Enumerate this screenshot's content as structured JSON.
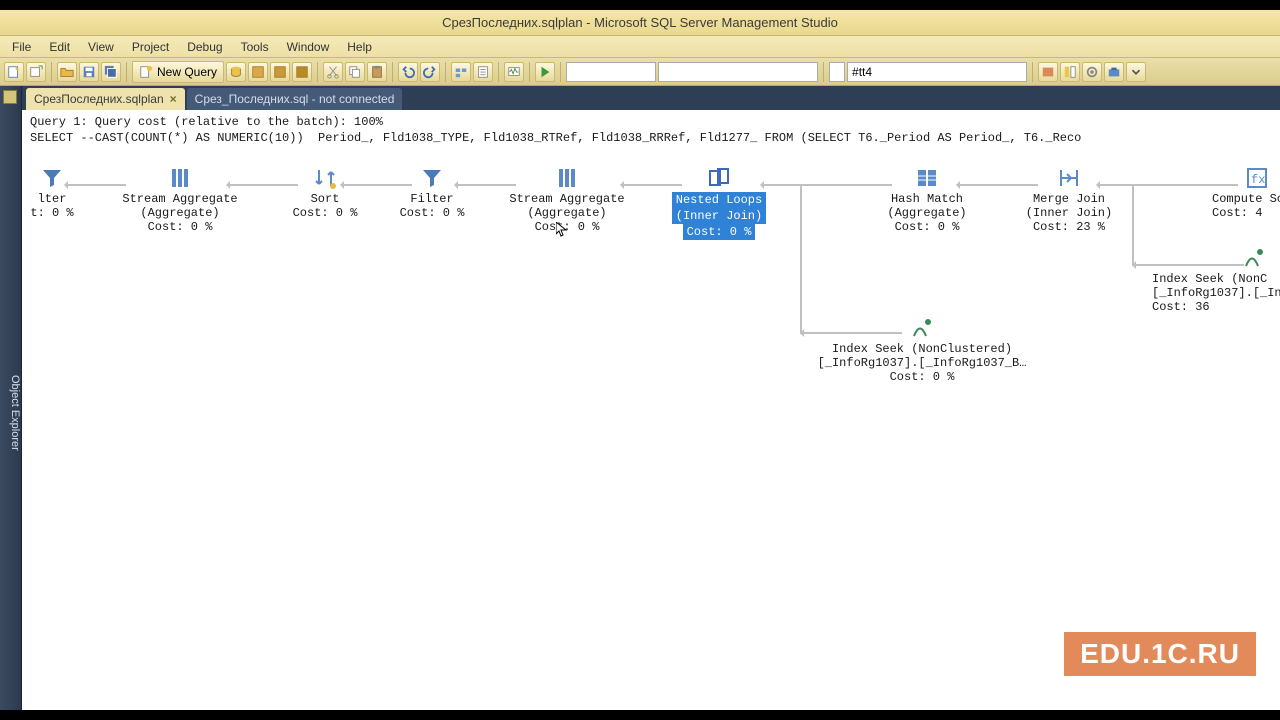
{
  "title": "СрезПоследних.sqlplan - Microsoft SQL Server Management Studio",
  "menu": [
    "File",
    "Edit",
    "View",
    "Project",
    "Debug",
    "Tools",
    "Window",
    "Help"
  ],
  "toolbar": {
    "new_query": "New Query",
    "combo_value": "#tt4"
  },
  "explorer_label": "Object Explorer",
  "tabs": [
    {
      "label": "СрезПоследних.sqlplan",
      "active": true,
      "closable": true
    },
    {
      "label": "Срез_Последних.sql - not connected",
      "active": false,
      "closable": false
    }
  ],
  "plan_header": {
    "line1": "Query 1: Query cost (relative to the batch): 100%",
    "line2": "SELECT --CAST(COUNT(*) AS NUMERIC(10))  Period_, Fld1038_TYPE, Fld1038_RTRef, Fld1038_RRRef, Fld1277_ FROM (SELECT T6._Period AS Period_, T6._Reco"
  },
  "nodes": {
    "filter_left": {
      "l1": "lter",
      "l2": "t: 0 %"
    },
    "stream_agg1": {
      "l1": "Stream Aggregate",
      "l2": "(Aggregate)",
      "l3": "Cost: 0 %"
    },
    "sort": {
      "l1": "Sort",
      "l2": "Cost: 0 %"
    },
    "filter": {
      "l1": "Filter",
      "l2": "Cost: 0 %"
    },
    "stream_agg2": {
      "l1": "Stream Aggregate",
      "l2": "(Aggregate)",
      "l3": "Cost: 0 %"
    },
    "nested": {
      "l1": "Nested Loops",
      "l2": "(Inner Join)",
      "l3": "Cost: 0 %"
    },
    "hash": {
      "l1": "Hash Match",
      "l2": "(Aggregate)",
      "l3": "Cost: 0 %"
    },
    "merge": {
      "l1": "Merge Join",
      "l2": "(Inner Join)",
      "l3": "Cost: 23 %"
    },
    "compute": {
      "l1": "Compute Sc",
      "l2": "Cost: 4"
    },
    "seek_top": {
      "l1": "Index Seek (NonC",
      "l2": "[_InfoRg1037].[_In",
      "l3": "Cost: 36"
    },
    "seek_bot": {
      "l1": "Index Seek (NonClustered)",
      "l2": "[_InfoRg1037].[_InfoRg1037_B…",
      "l3": "Cost: 0 %"
    }
  },
  "watermark": "EDU.1C.RU"
}
